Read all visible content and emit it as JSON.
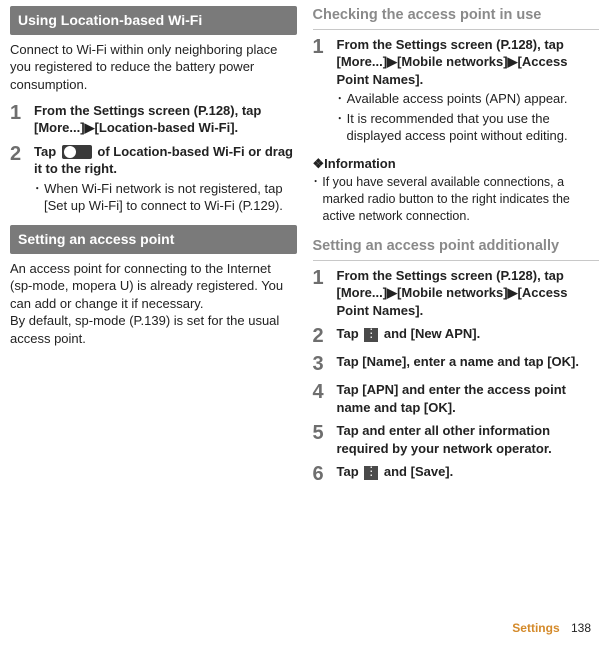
{
  "left": {
    "sec1_title": "Using Location-based Wi-Fi",
    "sec1_intro": "Connect to Wi-Fi within only neighboring place you registered to reduce the battery power consumption.",
    "sec1_step1": "From the Settings screen (P.128), tap [More...]▶[Location-based Wi-Fi].",
    "sec1_step2a": "Tap ",
    "sec1_step2b": " of Location-based Wi-Fi or drag it to the right.",
    "sec1_step2_note": "When Wi-Fi network is not registered, tap [Set up Wi-Fi] to connect to Wi-Fi (P.129).",
    "sec2_title": "Setting an access point",
    "sec2_body": "An access point for connecting to the Internet (sp-mode, mopera U) is already registered. You can add or change it if necessary.\nBy default, sp-mode (P.139) is set for the usual access point."
  },
  "right": {
    "heading1": "Checking the access point in use",
    "h1_step1": "From the Settings screen (P.128), tap [More...]▶[Mobile networks]▶[Access Point Names].",
    "h1_step1_note1": "Available access points (APN) appear.",
    "h1_step1_note2": "It is recommended that you use the displayed access point without editing.",
    "info_heading": "❖Information",
    "info_item": "If you have several available connections, a marked radio button to the right indicates the active network connection.",
    "heading2": "Setting an access point additionally",
    "h2_step1": "From the Settings screen (P.128), tap [More...]▶[Mobile networks]▶[Access Point Names].",
    "h2_step2a": "Tap ",
    "h2_step2b": " and [New APN].",
    "h2_step3": "Tap [Name], enter a name and tap [OK].",
    "h2_step4": "Tap [APN] and enter the access point name and tap [OK].",
    "h2_step5": "Tap and enter all other information required by your network operator.",
    "h2_step6a": "Tap ",
    "h2_step6b": " and [Save]."
  },
  "footer": {
    "label": "Settings",
    "page": "138"
  },
  "nums": {
    "n1": "1",
    "n2": "2",
    "n3": "3",
    "n4": "4",
    "n5": "5",
    "n6": "6"
  }
}
